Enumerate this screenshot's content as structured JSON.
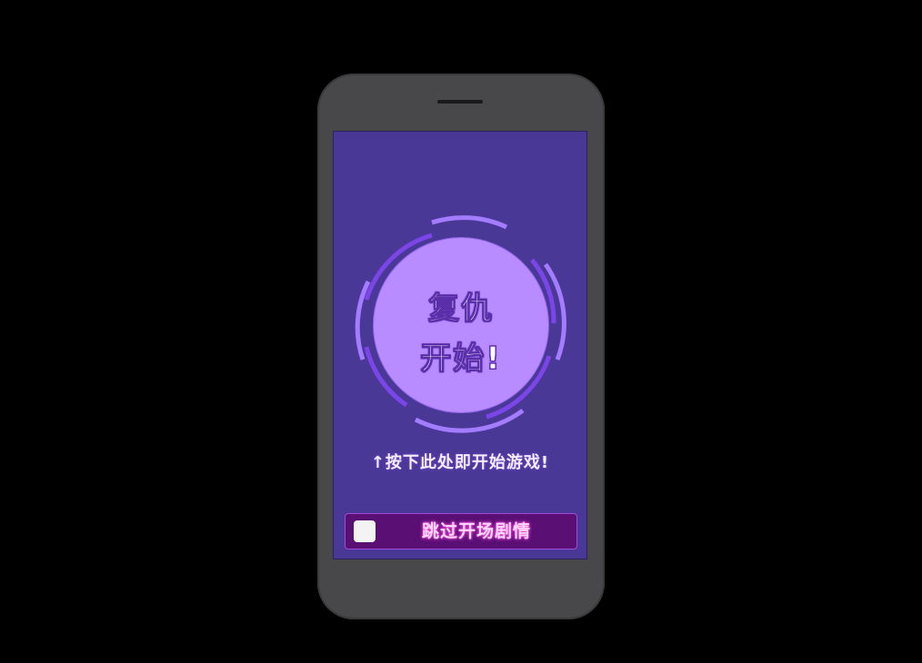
{
  "colors": {
    "background": "#000000",
    "phone_body": "#48484b",
    "screen_bg": "#4a3896",
    "start_circle": "#b88bff",
    "ring_light": "#a37cff",
    "ring_dark": "#7b45e8",
    "skip_bar": "#5a0f74",
    "skip_text_glow": "#ff4ae6"
  },
  "start_button": {
    "line1": "复仇",
    "line2": "开始!"
  },
  "hint": {
    "icon": "arrow-up-icon",
    "text": "↑按下此处即开始游戏!"
  },
  "skip": {
    "checked": false,
    "label": "跳过开场剧情"
  }
}
